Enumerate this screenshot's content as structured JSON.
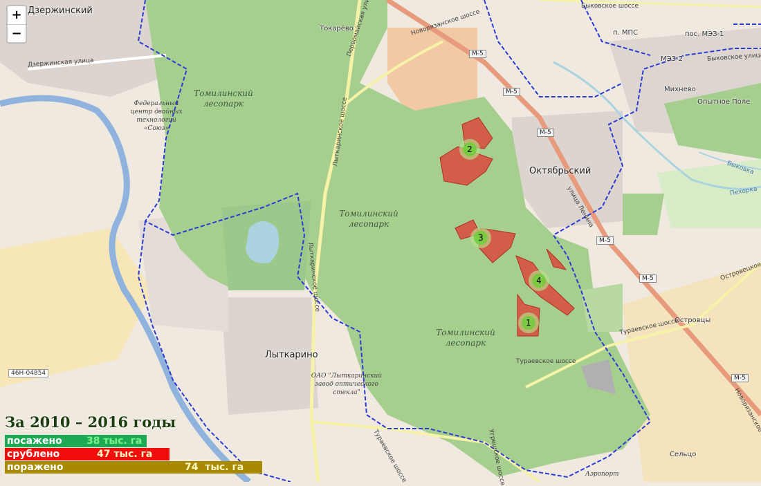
{
  "zoom": {
    "in_label": "+",
    "out_label": "−"
  },
  "labels": {
    "dzerzhinsky": "Дзержинский",
    "dzerzhinskaya_street": "Дзержинская улица",
    "tokarevo": "Токарёво",
    "novoryazanskoe": "Новорязанское шоссе",
    "pervomaiskaya": "Первомайская улица",
    "lytkarinskoe": "Лыткаринское шоссе",
    "lytkarinskoe2": "Лыткаринское шоссе",
    "mps": "п. МПС",
    "mez1": "пос. МЭЗ-1",
    "mez2": "МЭЗ-2",
    "bykovskaya": "Быковское улица",
    "bykovskoe": "Быковское шоссе",
    "mikhnevo": "Михнево",
    "opytnoe": "Опытное Поле",
    "oktyabrsky": "Октябрьский",
    "lenina": "улица Ленина",
    "bykovka": "Быковка",
    "pekhorka": "Пехорка",
    "ostrovtsy": "Островцы",
    "ostrovetskoe": "Островецкое",
    "turaevskoe1": "Тураевское шоссе",
    "turaevskoe2": "Тураевское шоссе",
    "turaevskoe3": "Тураевское шоссе",
    "ugreshskoe": "Угрешское шоссе",
    "lytkarino": "Лыткарино",
    "selco": "Сельцо",
    "airport": "Аэропорт",
    "novoryaz2": "Новорязанское шоссе",
    "road_46n": "46Н-04854",
    "forest1": "Томилинский лесопарк",
    "forest2": "Томилинский лесопарк",
    "forest3": "Томилинский лесопарк",
    "poi_soyuz": "Федеральный центр двойных технологий «Союз»",
    "poi_lzos": "ОАО \"Лыткаринский завод оптического стекла\""
  },
  "shields": [
    "M-5",
    "M-5",
    "M-5",
    "M-5",
    "M-5",
    "M-5"
  ],
  "clusters": [
    "1",
    "2",
    "3",
    "4"
  ],
  "stats": {
    "title": "За 2010 – 2016 годы",
    "planted_label": "посажено",
    "planted_value": "38 тыс. га",
    "cut_label": "срублено",
    "cut_value": "47 тыс. га",
    "damaged_label": "поражено",
    "damaged_value": "74  тыс. га"
  },
  "colors": {
    "forest": "#a6cf8f",
    "boundary": "#2a3bd4",
    "river": "#8fb3dd",
    "highway": "#e79a7c",
    "cut_area": "#d94a3d",
    "planted_bar": "#1eaa55",
    "cut_bar": "#f20d0d",
    "damaged_bar": "#a88a00"
  }
}
